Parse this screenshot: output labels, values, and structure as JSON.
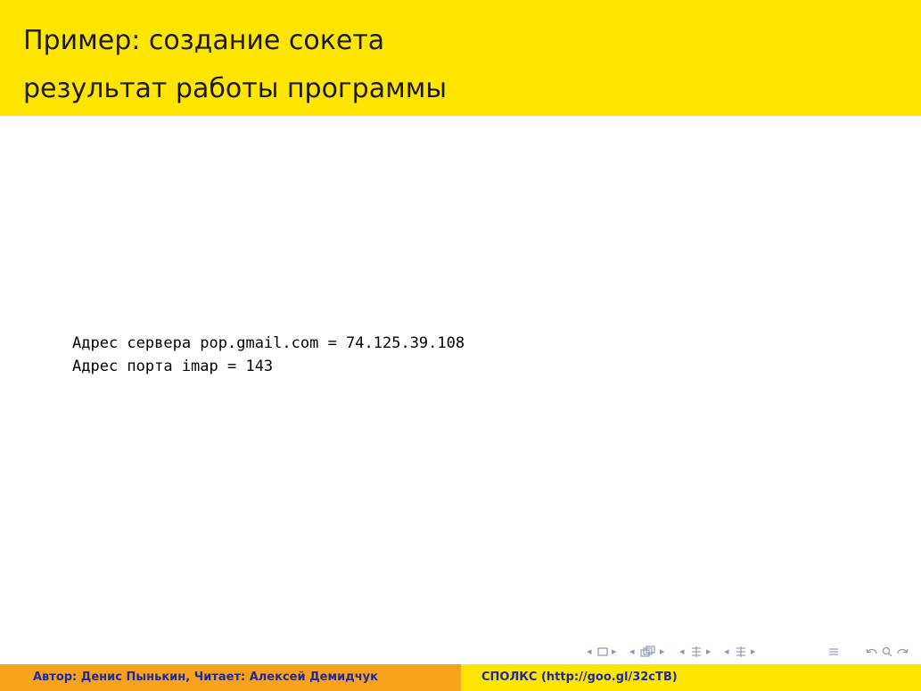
{
  "slide": {
    "title_lines": [
      "Пример: создание сокета",
      "результат работы программы"
    ],
    "output_lines": [
      "Адрес сервера pop.gmail.com = 74.125.39.108",
      "Адрес порта imap = 143"
    ]
  },
  "navigation": {
    "icons": [
      "arrow-left-icon",
      "frame-icon",
      "arrow-right-icon",
      "arrow-left-icon",
      "subsection-icon",
      "arrow-right-icon",
      "arrow-left-icon",
      "section-icon",
      "arrow-right-icon",
      "arrow-left-icon",
      "document-icon",
      "arrow-right-icon",
      "align-icon",
      "back-icon",
      "search-icon",
      "forward-icon"
    ],
    "color": "#8b97b6"
  },
  "footer": {
    "author": "Автор: Денис Пынькин, Читает: Алексей Демидчук",
    "course": "СПОЛКС (http://goo.gl/32cTB)"
  },
  "colors": {
    "header_bg": "#ffe500",
    "footer_left_bg": "#f9a21b",
    "footer_right_bg": "#ffe500",
    "footer_text": "#1f2a9c"
  }
}
